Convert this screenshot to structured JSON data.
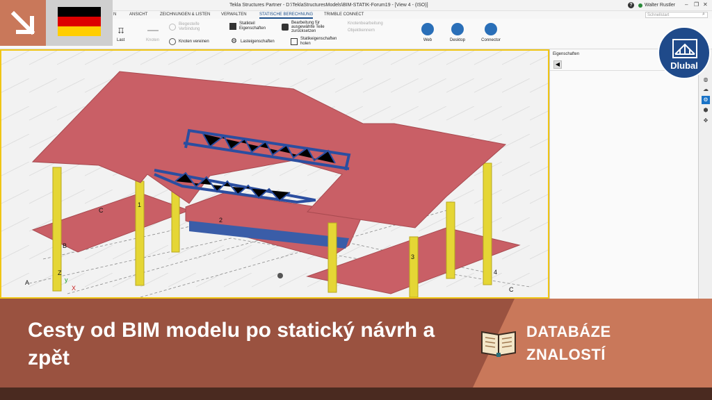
{
  "window": {
    "title": "Tekla Structures Partner - D:\\TeklaStructuresModels\\BIM-STATIK-Forum19 - [View 4 - (ISO)]",
    "user": "Walter Rustler",
    "help": "?"
  },
  "tabs": [
    {
      "label": "N"
    },
    {
      "label": "ANSICHT"
    },
    {
      "label": "ZEICHNUNGEN & LISTEN"
    },
    {
      "label": "VERWALTEN"
    },
    {
      "label": "STATISCHE BERECHNUNG"
    },
    {
      "label": "TRIMBLE CONNECT"
    }
  ],
  "search": {
    "placeholder": "Schnellstart"
  },
  "ribbon": {
    "last": "Last",
    "knoten": "Knoten",
    "biegesteife": "Biegesteife Verbindung",
    "knoten_vereinen": "Knoten vereinen",
    "statikteil": "Statikteil Eigenschaften",
    "lasteigenschaften": "Lasteigenschaften",
    "bearbeitung": "Bearbeitung für ausgewählte Teile zurücksetzen",
    "statikeigenschaften_holen": "Statikeigenschaften holen",
    "knotenbearbeitung": "Knotenbearbeitung",
    "objektkenner": "Objektkennern",
    "web": "Web",
    "desktop": "Desktop",
    "connector": "Connector"
  },
  "properties": {
    "title": "Eigenschaften",
    "back": "◀"
  },
  "model_labels": {
    "c1": "C",
    "b": "B",
    "a": "A",
    "one": "1",
    "two": "2",
    "three": "3",
    "four": "4",
    "c2": "C",
    "z": "Z",
    "y": "y",
    "x": "X"
  },
  "side_icons": [
    "◍",
    "☁",
    "⚙",
    "⬢",
    "✥"
  ],
  "logo": {
    "text": "Dlubal"
  },
  "banner": {
    "headline": "Cesty od BIM modelu po statický návrh a zpět",
    "kb_line1": "DATABÁZE",
    "kb_line2": "ZNALOSTÍ"
  },
  "colors": {
    "slab": "#c95f66",
    "column": "#e5d635",
    "truss": "#2b4ea0",
    "banner": "#9a5240",
    "accent": "#c9785a",
    "logo": "#1f4a8a"
  }
}
